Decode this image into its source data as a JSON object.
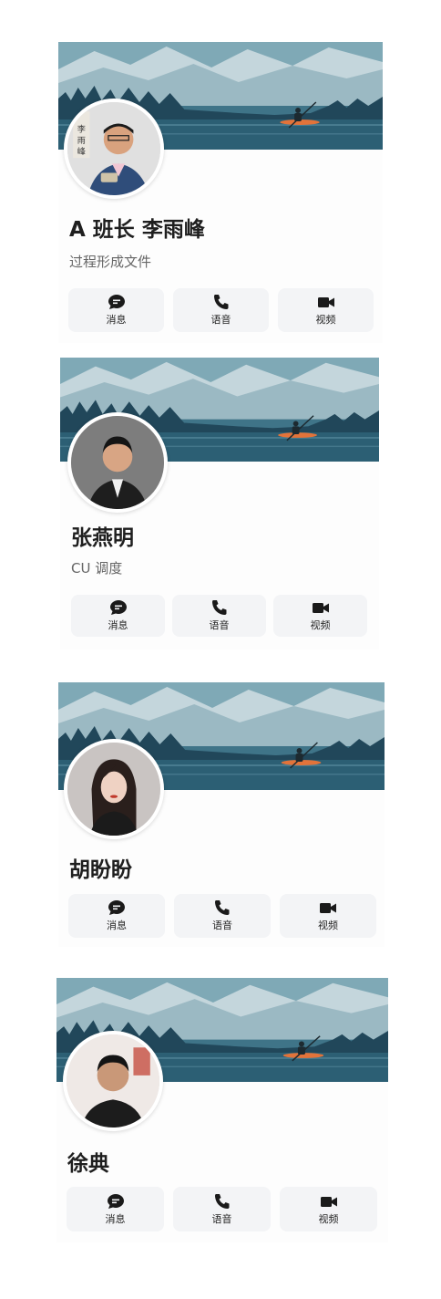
{
  "contacts": [
    {
      "name": "A 班长 李雨峰",
      "subtitle": "过程形成文件",
      "actions": [
        {
          "label": "消息",
          "icon": "message-icon"
        },
        {
          "label": "语音",
          "icon": "phone-icon"
        },
        {
          "label": "视频",
          "icon": "video-camera-icon"
        }
      ]
    },
    {
      "name": "张燕明",
      "subtitle": "CU 调度",
      "actions": [
        {
          "label": "消息",
          "icon": "message-icon"
        },
        {
          "label": "语音",
          "icon": "phone-icon"
        },
        {
          "label": "视频",
          "icon": "video-camera-icon"
        }
      ]
    },
    {
      "name": "胡盼盼",
      "actions": [
        {
          "label": "消息",
          "icon": "message-icon"
        },
        {
          "label": "语音",
          "icon": "phone-icon"
        },
        {
          "label": "视频",
          "icon": "video-camera-icon"
        }
      ]
    },
    {
      "name": "徐典",
      "actions": [
        {
          "label": "消息",
          "icon": "message-icon"
        },
        {
          "label": "语音",
          "icon": "phone-icon"
        },
        {
          "label": "视频",
          "icon": "video-camera-icon"
        }
      ]
    }
  ]
}
